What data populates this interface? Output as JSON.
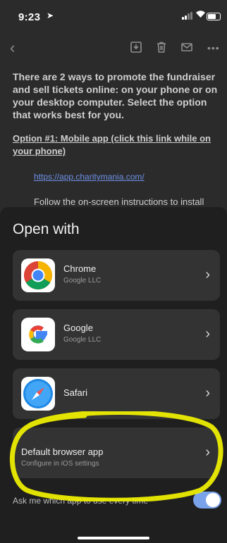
{
  "status": {
    "time": "9:23",
    "location_icon": "location-arrow-icon"
  },
  "toolbar": {
    "icons": [
      "back-icon",
      "archive-icon",
      "trash-icon",
      "mail-icon",
      "more-icon"
    ]
  },
  "email": {
    "intro": "There are 2 ways to promote the fundraiser and sell tickets online: on your phone or on your desktop computer. Select the option that works best for you.",
    "option1": "Option #1: Mobile app (click this link while on your phone)",
    "link": "https://app.charitymania.com/",
    "follow": "Follow the on-screen instructions to install the app. Make sure to log in with the email"
  },
  "sheet": {
    "title": "Open with",
    "apps": [
      {
        "name": "Chrome",
        "developer": "Google LLC"
      },
      {
        "name": "Google",
        "developer": "Google LLC"
      },
      {
        "name": "Safari",
        "developer": ""
      }
    ],
    "default_browser": {
      "label": "Default browser app",
      "sub": "Configure in iOS settings"
    },
    "ask_label": "Ask me which app to use every time",
    "ask_enabled": true
  },
  "colors": {
    "highlight": "#f2f200",
    "toggle_on": "#7aa2ea",
    "link": "#6d8fe6"
  }
}
